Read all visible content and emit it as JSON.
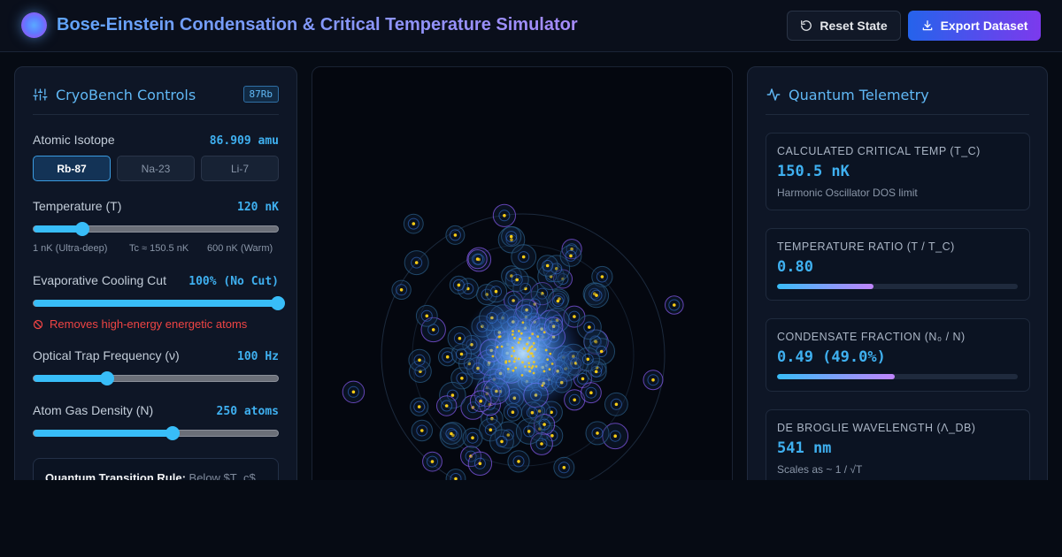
{
  "header": {
    "title": "Bose-Einstein Condensation & Critical Temperature Simulator",
    "reset_label": "Reset State",
    "export_label": "Export Dataset"
  },
  "controls": {
    "title": "CryoBench Controls",
    "badge": "87Rb",
    "isotope": {
      "label": "Atomic Isotope",
      "value": "86.909 amu",
      "options": [
        "Rb-87",
        "Na-23",
        "Li-7"
      ],
      "selected": "Rb-87"
    },
    "temperature": {
      "label": "Temperature (T)",
      "value": "120 nK",
      "fraction": 0.2,
      "ticks": [
        "1 nK (Ultra-deep)",
        "Tc ≈ 150.5 nK",
        "600 nK (Warm)"
      ]
    },
    "evaporative": {
      "label": "Evaporative Cooling Cut",
      "value": "100% (No Cut)",
      "fraction": 1.0,
      "warning": "Removes high-energy energetic atoms"
    },
    "trap": {
      "label": "Optical Trap Frequency (ν)",
      "value": "100 Hz",
      "fraction": 0.3
    },
    "density": {
      "label": "Atom Gas Density (N)",
      "value": "250 atoms",
      "fraction": 0.57
    },
    "rule": {
      "label": "Quantum Transition Rule:",
      "text": "Below $T_c$"
    }
  },
  "telemetry": {
    "title": "Quantum Telemetry",
    "metrics": [
      {
        "label": "CALCULATED CRITICAL TEMP (T_C)",
        "value": "150.5 nK",
        "sub": "Harmonic Oscillator DOS limit"
      },
      {
        "label": "TEMPERATURE RATIO (T / T_C)",
        "value": "0.80",
        "bar": 0.4
      },
      {
        "label": "CONDENSATE FRACTION (N₀ / N)",
        "value": "0.49 (49.0%)",
        "bar": 0.49
      },
      {
        "label": "DE BROGLIE WAVELENGTH (Λ_DB)",
        "value": "541 nm",
        "sub": "Scales as ~ 1 / √T"
      }
    ]
  },
  "colors": {
    "accent": "#38bdf8",
    "purple": "#a78bfa",
    "danger": "#ef4444",
    "atom_core": "#facc15"
  },
  "icons": {
    "logo": "quantum-orb-icon",
    "reset": "rotate-ccw-icon",
    "export": "download-icon",
    "controls": "sliders-icon",
    "warning": "ban-icon",
    "telemetry": "activity-icon"
  }
}
